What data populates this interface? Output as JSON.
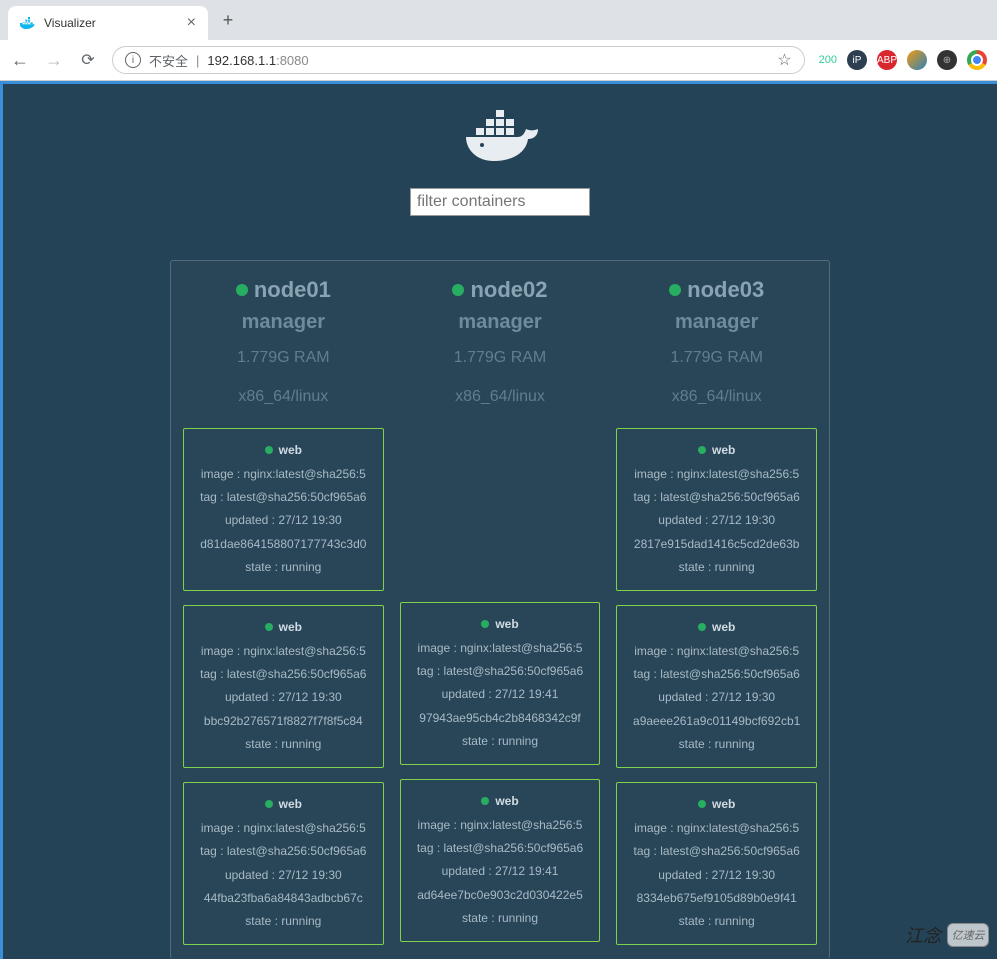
{
  "browser": {
    "tab_title": "Visualizer",
    "insecure_label": "不安全",
    "url_host": "192.168.1.1",
    "url_port": ":8080",
    "ext_badge": "200"
  },
  "page": {
    "filter_placeholder": "filter containers"
  },
  "nodes": [
    {
      "name": "node01",
      "role": "manager",
      "ram": "1.779G RAM",
      "arch": "x86_64/linux",
      "containers": [
        {
          "service": "web",
          "image": "image : nginx:latest@sha256:5",
          "tag": "tag : latest@sha256:50cf965a6",
          "updated": "updated : 27/12 19:30",
          "id": "d81dae864158807177743c3d0",
          "state": "state : running"
        },
        {
          "service": "web",
          "image": "image : nginx:latest@sha256:5",
          "tag": "tag : latest@sha256:50cf965a6",
          "updated": "updated : 27/12 19:30",
          "id": "bbc92b276571f8827f7f8f5c84",
          "state": "state : running"
        },
        {
          "service": "web",
          "image": "image : nginx:latest@sha256:5",
          "tag": "tag : latest@sha256:50cf965a6",
          "updated": "updated : 27/12 19:30",
          "id": "44fba23fba6a84843adbcb67c",
          "state": "state : running"
        }
      ]
    },
    {
      "name": "node02",
      "role": "manager",
      "ram": "1.779G RAM",
      "arch": "x86_64/linux",
      "containers": [
        {
          "placeholder": true
        },
        {
          "service": "web",
          "image": "image : nginx:latest@sha256:5",
          "tag": "tag : latest@sha256:50cf965a6",
          "updated": "updated : 27/12 19:41",
          "id": "97943ae95cb4c2b8468342c9f",
          "state": "state : running"
        },
        {
          "service": "web",
          "image": "image : nginx:latest@sha256:5",
          "tag": "tag : latest@sha256:50cf965a6",
          "updated": "updated : 27/12 19:41",
          "id": "ad64ee7bc0e903c2d030422e5",
          "state": "state : running"
        }
      ]
    },
    {
      "name": "node03",
      "role": "manager",
      "ram": "1.779G RAM",
      "arch": "x86_64/linux",
      "containers": [
        {
          "service": "web",
          "image": "image : nginx:latest@sha256:5",
          "tag": "tag : latest@sha256:50cf965a6",
          "updated": "updated : 27/12 19:30",
          "id": "2817e915dad1416c5cd2de63b",
          "state": "state : running"
        },
        {
          "service": "web",
          "image": "image : nginx:latest@sha256:5",
          "tag": "tag : latest@sha256:50cf965a6",
          "updated": "updated : 27/12 19:30",
          "id": "a9aeee261a9c01149bcf692cb1",
          "state": "state : running"
        },
        {
          "service": "web",
          "image": "image : nginx:latest@sha256:5",
          "tag": "tag : latest@sha256:50cf965a6",
          "updated": "updated : 27/12 19:30",
          "id": "8334eb675ef9105d89b0e9f41",
          "state": "state : running"
        }
      ]
    }
  ],
  "watermark": {
    "text": "江念",
    "brand": "亿速云"
  }
}
